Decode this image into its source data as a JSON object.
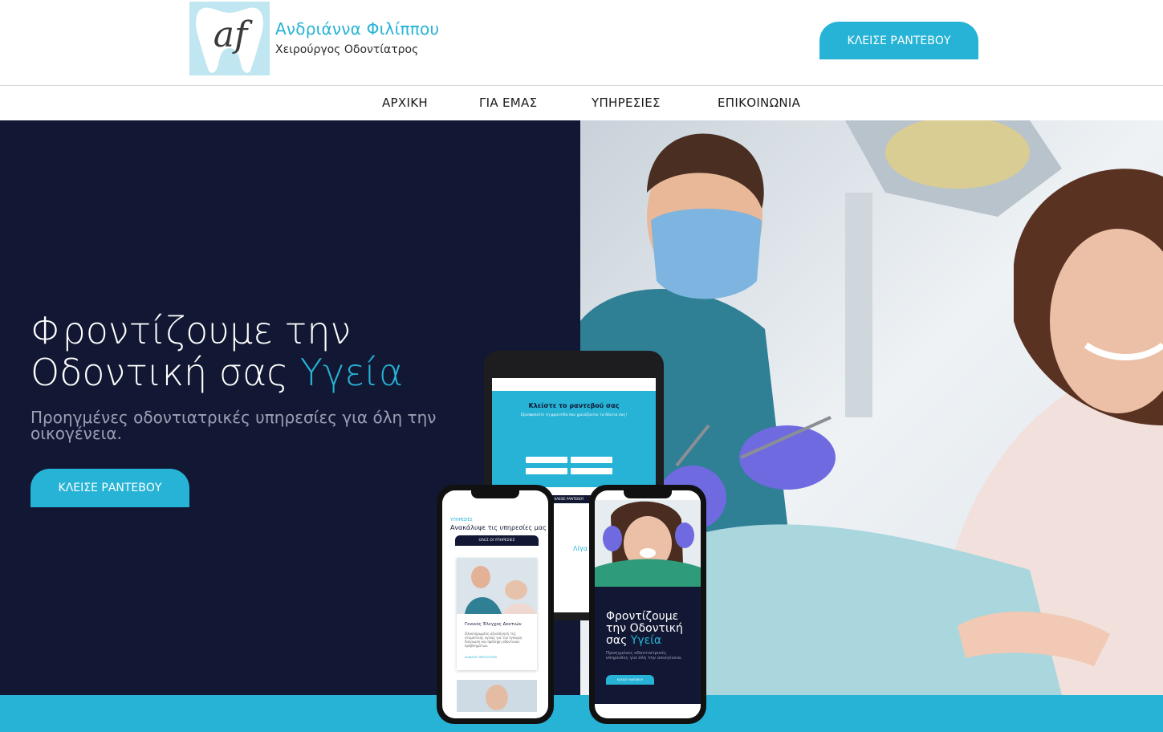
{
  "brand": {
    "logo_text": "af",
    "name": "Ανδριάννα Φιλίππου",
    "subtitle": "Χειρούργος Οδοντίατρος"
  },
  "header": {
    "cta_label": "ΚΛΕΙΣΕ ΡΑΝΤΕΒΟΥ"
  },
  "nav": {
    "items": [
      "ΑΡΧΙΚΗ",
      "ΓΙΑ ΕΜΑΣ",
      "ΥΠΗΡΕΣΙΕΣ",
      "ΕΠΙΚΟΙΝΩΝΙΑ"
    ]
  },
  "hero": {
    "title_line1": "Φροντίζουμε την",
    "title_line2": "Οδοντική σας",
    "title_accent": "Υγεία",
    "subtitle": "Προηγμένες οδοντιατρικές υπηρεσίες για όλη την οικογένεια.",
    "cta_label": "ΚΛΕΙΣΕ ΡΑΝΤΕΒΟΥ"
  },
  "mockups": {
    "tablet": {
      "form_title": "Κλείστε το ραντεβού σας",
      "form_tagline": "Εξασφαλίστε τη φροντίδα που χρειάζονται τα δόντια σας!",
      "submit_label": "ΚΛΕΙΣΕ ΡΑΝΤΕΒΟΥ",
      "about_label": "Λίγα λό"
    },
    "phone_services": {
      "category": "ΥΠΗΡΕΣΙΕΣ",
      "heading": "Ανακάλυψε τις υπηρεσίες μας",
      "button": "ΟΛΕΣ ΟΙ ΥΠΗΡΕΣΙΕΣ",
      "card_title": "Γενικός Έλεγχος Δοντιών",
      "card_text": "Ολοκληρωμένη αξιολόγηση της στοματικής υγείας για την έγκαιρη διάγνωση και πρόληψη οδοντικών προβλημάτων.",
      "card_link": "ΔΙΑΒΑΣΕ ΠΕΡΙΣΣΟΤΕΡΑ"
    },
    "phone_hero": {
      "title_line1": "Φροντίζουμε",
      "title_line2": "την Οδοντική",
      "title_line3": "σας",
      "title_accent": "Υγεία",
      "subtitle": "Προηγμένες οδοντιατρικές υπηρεσίες για όλη την οικογένεια.",
      "cta_label": "ΚΛΕΙΣΕ ΡΑΝΤΕΒΟΥ"
    }
  },
  "colors": {
    "accent": "#26b3d6",
    "navy": "#121833"
  }
}
